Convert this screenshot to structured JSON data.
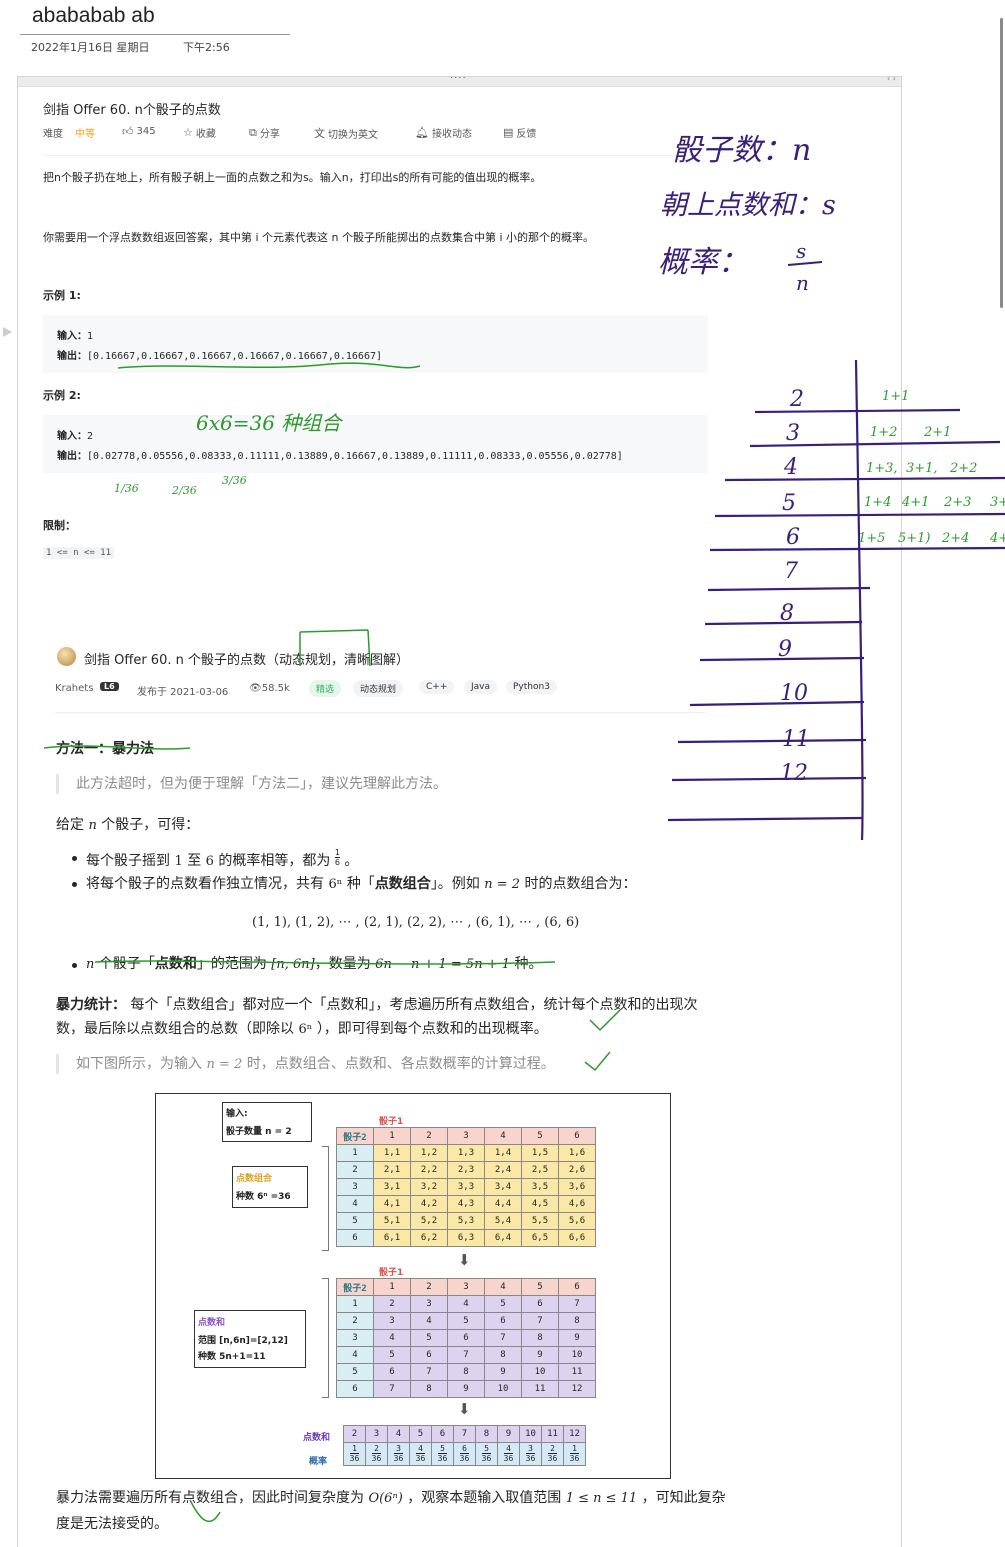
{
  "note": {
    "title": "abababab ab",
    "date": "2022年1月16日 星期日",
    "time": "下午2:56"
  },
  "clip": {
    "toolbar_dots": "····",
    "toolbar_arrows": "‹ ›"
  },
  "problem": {
    "title": "剑指 Offer 60. n个骰子的点数",
    "meta": {
      "difficulty_label": "难度",
      "difficulty_value": "中等",
      "likes": "345",
      "favorite": "收藏",
      "share": "分享",
      "switch_lang": "切换为英文",
      "notify": "接收动态",
      "feedback": "反馈"
    },
    "desc1": "把n个骰子扔在地上，所有骰子朝上一面的点数之和为s。输入n，打印出s的所有可能的值出现的概率。",
    "desc2": "你需要用一个浮点数数组返回答案，其中第 i 个元素代表这 n 个骰子所能掷出的点数集合中第 i 小的那个的概率。",
    "example1": {
      "heading": "示例 1:",
      "input_label": "输入：",
      "input_value": "1",
      "output_label": "输出：",
      "output_value": "[0.16667,0.16667,0.16667,0.16667,0.16667,0.16667]"
    },
    "example2": {
      "heading": "示例 2:",
      "input_label": "输入：",
      "input_value": "2",
      "output_label": "输出：",
      "output_value": "[0.02778,0.05556,0.08333,0.11111,0.13889,0.16667,0.13889,0.11111,0.08333,0.05556,0.02778]"
    },
    "limit_heading": "限制：",
    "limit_value": "1 <= n <= 11"
  },
  "solution": {
    "title": "剑指 Offer 60. n 个骰子的点数（动态规划，清晰图解）",
    "author": "Krahets",
    "badge": "L6",
    "posted": "发布于 2021-03-06",
    "views": "58.5k",
    "tags": [
      "精选",
      "动态规划",
      "C++",
      "Java",
      "Python3"
    ],
    "method1_heading": "方法一：暴力法",
    "method1_quote": "此方法超时，但为便于理解「方法二」，建议先理解此方法。",
    "given_pre": "给定",
    "given_var": "n",
    "given_post": "个骰子，可得：",
    "bullet1_pre": "每个骰子摇到",
    "bullet1_a": "1",
    "bullet1_mid": "至",
    "bullet1_b": "6",
    "bullet1_post": "的概率相等，都为",
    "bullet1_frac_num": "1",
    "bullet1_frac_den": "6",
    "bullet1_end": "。",
    "bullet2_pre": "将每个骰子的点数看作独立情况，共有",
    "bullet2_expr": "6ⁿ",
    "bullet2_mid": "种「",
    "bullet2_bold": "点数组合",
    "bullet2_post": "」。例如",
    "bullet2_expr2": "n = 2",
    "bullet2_end": "时的点数组合为：",
    "combos_formula": "(1, 1), (1, 2), ⋯ , (2, 1), (2, 2), ⋯ , (6, 1), ⋯ , (6, 6)",
    "bullet3_var": "n",
    "bullet3_pre": "个骰子「",
    "bullet3_bold": "点数和",
    "bullet3_mid": "」的范围为",
    "bullet3_range": "[n, 6n]",
    "bullet3_mid2": "，数量为",
    "bullet3_count": "6n − n + 1 = 5n + 1",
    "bullet3_end": "种。",
    "stat_bold": "暴力统计：",
    "stat_line1": "每个「点数组合」都对应一个「点数和」，考虑遍历所有点数组合，统计每个点数和的出现次",
    "stat_line2_pre": "数，最后除以点数组合的总数（即除以",
    "stat_line2_expr": "6ⁿ",
    "stat_line2_post": "），即可得到每个点数和的出现概率。",
    "figure_quote_pre": "如下图所示，为输入",
    "figure_quote_expr": "n = 2",
    "figure_quote_post": "时，点数组合、点数和、各点数概率的计算过程。",
    "conclusion_pre": "暴力法需要遍历所有点数组合，因此时间复杂度为",
    "conclusion_expr": "O(6ⁿ)",
    "conclusion_mid": "，观察本题输入取值范围",
    "conclusion_range": "1 ≤ n ≤ 11",
    "conclusion_post": "，可知此复杂",
    "conclusion_line2": "度是无法接受的。"
  },
  "figure": {
    "input_title": "输入:",
    "input_line": "骰子数量 n = 2",
    "combo_title": "点数组合",
    "combo_line": "种数 6ⁿ =36",
    "sum_title": "点数和",
    "sum_range": "范围 [n,6n]=[2,12]",
    "sum_count": "种数 5n+1=11",
    "dice1_label": "骰子1",
    "dice2_label": "骰子2",
    "headers": [
      "1",
      "2",
      "3",
      "4",
      "5",
      "6"
    ],
    "combo_rows": [
      [
        "1,1",
        "1,2",
        "1,3",
        "1,4",
        "1,5",
        "1,6"
      ],
      [
        "2,1",
        "2,2",
        "2,3",
        "2,4",
        "2,5",
        "2,6"
      ],
      [
        "3,1",
        "3,2",
        "3,3",
        "3,4",
        "3,5",
        "3,6"
      ],
      [
        "4,1",
        "4,2",
        "4,3",
        "4,4",
        "4,5",
        "4,6"
      ],
      [
        "5,1",
        "5,2",
        "5,3",
        "5,4",
        "5,5",
        "5,6"
      ],
      [
        "6,1",
        "6,2",
        "6,3",
        "6,4",
        "6,5",
        "6,6"
      ]
    ],
    "sum_rows": [
      [
        "2",
        "3",
        "4",
        "5",
        "6",
        "7"
      ],
      [
        "3",
        "4",
        "5",
        "6",
        "7",
        "8"
      ],
      [
        "4",
        "5",
        "6",
        "7",
        "8",
        "9"
      ],
      [
        "5",
        "6",
        "7",
        "8",
        "9",
        "10"
      ],
      [
        "6",
        "7",
        "8",
        "9",
        "10",
        "11"
      ],
      [
        "7",
        "8",
        "9",
        "10",
        "11",
        "12"
      ]
    ],
    "sum_label": "点数和",
    "prob_label": "概率",
    "sums": [
      "2",
      "3",
      "4",
      "5",
      "6",
      "7",
      "8",
      "9",
      "10",
      "11",
      "12"
    ],
    "prob_num": [
      "1",
      "2",
      "3",
      "4",
      "5",
      "6",
      "5",
      "4",
      "3",
      "2",
      "1"
    ],
    "prob_den": "36"
  },
  "handwriting": {
    "note_line1": "骰子数：n",
    "note_line2": "朝上点数和：s",
    "note_line3_a": "概率：",
    "note_line3_num": "s",
    "note_line3_den": "n",
    "combos_note": "6x6=36 种组合",
    "frac1": "1/36",
    "frac2": "2/36",
    "frac3": "3/36",
    "table_sums": [
      "2",
      "3",
      "4",
      "5",
      "6",
      "7",
      "8",
      "9",
      "10",
      "11",
      "12"
    ],
    "table_pairs": [
      [
        "1+1"
      ],
      [
        "1+2",
        "2+1"
      ],
      [
        "1+3,",
        "3+1,",
        "2+2"
      ],
      [
        "1+4",
        "4+1",
        "2+3",
        "3+"
      ],
      [
        "1+5",
        "5+1)",
        "2+4",
        "4+"
      ]
    ],
    "ink_green": "#2e9a2e",
    "ink_purple": "#3a1f7a"
  }
}
